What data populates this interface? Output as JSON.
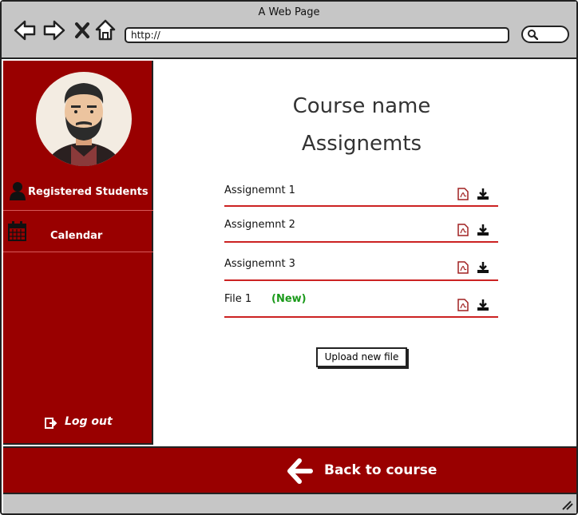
{
  "window": {
    "title": "A Web Page"
  },
  "browser": {
    "url": "http://"
  },
  "sidebar": {
    "items": [
      {
        "label": "Registered Students",
        "icon": "user-icon"
      },
      {
        "label": "Calendar",
        "icon": "calendar-icon"
      }
    ],
    "logout_label": "Log out"
  },
  "main": {
    "course_title": "Course name",
    "section_title": "Assignemts",
    "files": [
      {
        "name": "Assignemnt 1"
      },
      {
        "name": "Assignemnt 2"
      },
      {
        "name": "Assignemnt 3"
      },
      {
        "name": "File 1",
        "badge": "(New)"
      }
    ],
    "upload_label": "Upload new file"
  },
  "footer": {
    "back_label": "Back to course"
  },
  "colors": {
    "brand": "#990000",
    "new_badge": "#1a9a1a",
    "divider": "#cc2222"
  }
}
